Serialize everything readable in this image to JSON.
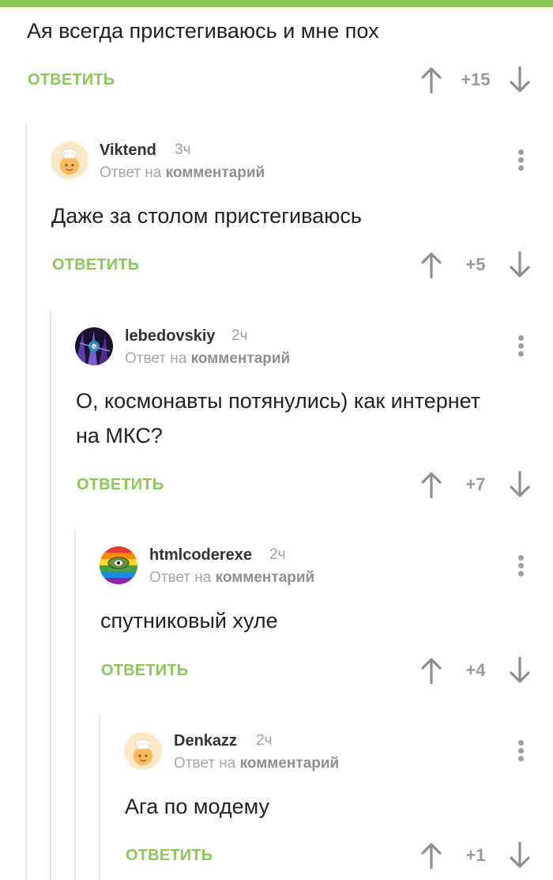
{
  "top_comment": {
    "text": "Ая всегда пристегиваюсь и мне пох",
    "reply_label": "ОТВЕТИТЬ",
    "rating": "+15"
  },
  "comments": [
    {
      "username": "Viktend",
      "time": "3ч",
      "reply_to_prefix": "Ответ на",
      "reply_to_link": "комментарий",
      "text": "Даже за столом пристегиваюсь",
      "reply_label": "ОТВЕТИТЬ",
      "rating": "+5",
      "avatar": "default-chef-avatar"
    },
    {
      "username": "lebedovskiy",
      "time": "2ч",
      "reply_to_prefix": "Ответ на",
      "reply_to_link": "комментарий",
      "text_line1": "О, космонавты потянулись) как интернет",
      "text_line2": "на МКС?",
      "reply_label": "ОТВЕТИТЬ",
      "rating": "+7",
      "avatar": "dark-purple-avatar"
    },
    {
      "username": "htmlcoderexe",
      "time": "2ч",
      "reply_to_prefix": "Ответ на",
      "reply_to_link": "комментарий",
      "text": "спутниковый хуле",
      "reply_label": "ОТВЕТИТЬ",
      "rating": "+4",
      "avatar": "rainbow-frog-avatar"
    },
    {
      "username": "Denkazz",
      "time": "2ч",
      "reply_to_prefix": "Ответ на",
      "reply_to_link": "комментарий",
      "text": "Ага по модему",
      "reply_label": "ОТВЕТИТЬ",
      "rating": "+1",
      "avatar": "default-chef-avatar"
    }
  ],
  "colors": {
    "accent": "#8ac858",
    "text": "#222222",
    "muted": "#a0a0a0",
    "thread_line": "#e4e4e4"
  },
  "icons": [
    "arrow-up-icon",
    "arrow-down-icon",
    "more-vertical-icon"
  ]
}
